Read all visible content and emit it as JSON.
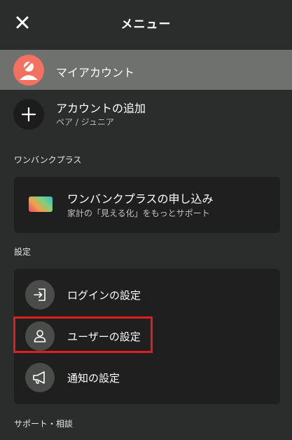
{
  "header": {
    "title": "メニュー",
    "close_icon": "close-icon"
  },
  "my_account": {
    "label": "マイアカウント",
    "avatar_color": "#f27160"
  },
  "add_account": {
    "label": "アカウントの追加",
    "sub": "ペア / ジュニア",
    "icon": "plus-icon"
  },
  "sections": {
    "plus": "ワンバンクプラス",
    "settings": "設定",
    "support": "サポート・相談"
  },
  "plus_card": {
    "title": "ワンバンクプラスの申し込み",
    "sub": "家計の「見える化」をもっとサポート"
  },
  "settings": {
    "items": [
      {
        "label": "ログインの設定",
        "icon": "login-icon"
      },
      {
        "label": "ユーザーの設定",
        "icon": "user-icon"
      },
      {
        "label": "通知の設定",
        "icon": "megaphone-icon"
      }
    ]
  },
  "colors": {
    "background": "#2b2d2c",
    "card": "#1e1f1e",
    "selected_row": "#6f716f",
    "highlight": "#e01e1e"
  }
}
